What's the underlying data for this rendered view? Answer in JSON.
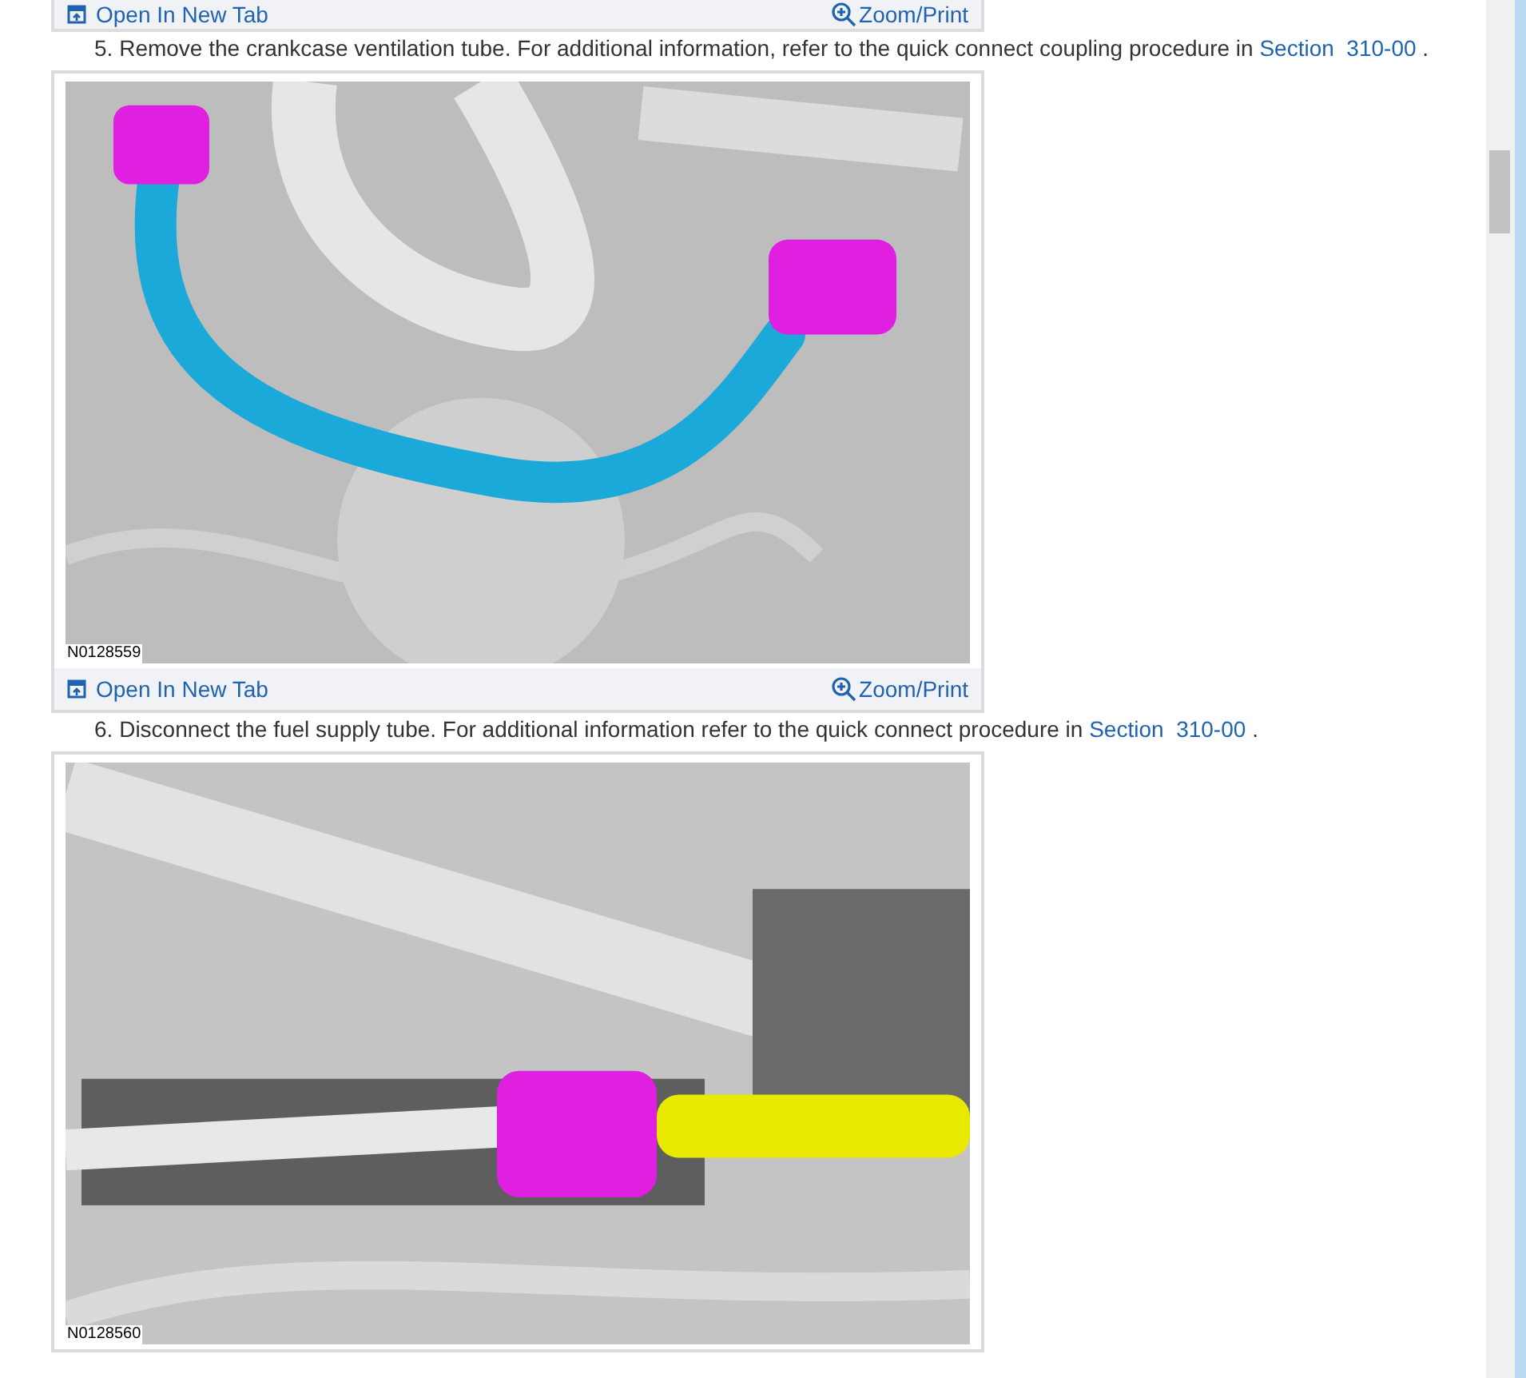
{
  "items": [
    {
      "kind": "link_bar",
      "open_link": "Open In New Tab",
      "zoom_link": "Zoom/Print"
    },
    {
      "kind": "step",
      "number": "5.",
      "text": "Remove the crankcase ventilation tube. For additional information, refer to the quick connect coupling procedure in",
      "link": "Section  310-00",
      "end": "."
    },
    {
      "kind": "figure",
      "figure_id": "N0128559",
      "open_link": "Open In New Tab",
      "zoom_link": "Zoom/Print"
    },
    {
      "kind": "step",
      "number": "6.",
      "text": "Disconnect the fuel supply tube. For additional information refer to the quick connect procedure in",
      "link": "Section  310-00",
      "end": "."
    },
    {
      "kind": "figure",
      "figure_id": "N0128560"
    }
  ]
}
